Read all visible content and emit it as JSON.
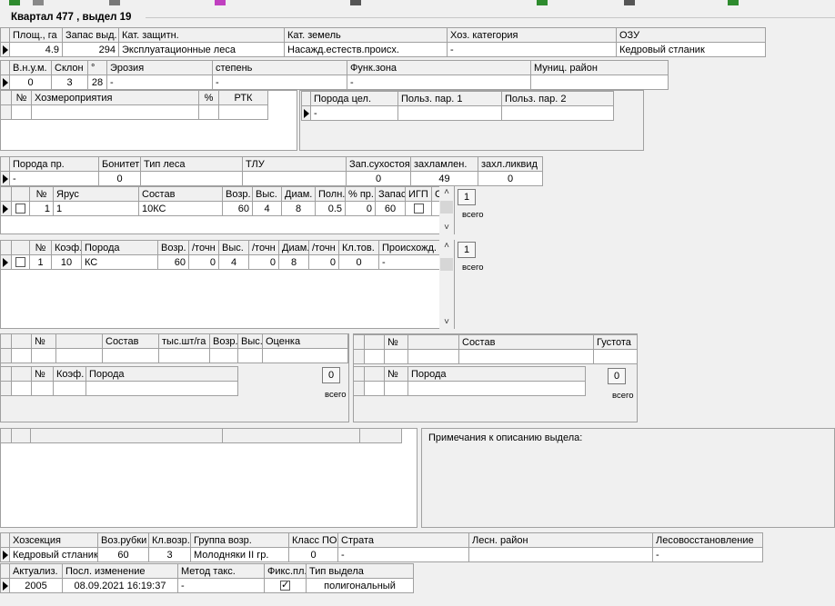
{
  "title": "Квартал 477 ,  выдел 19",
  "main": {
    "headers": [
      "Площ., га",
      "Запас выд.",
      "Кат. защитн.",
      "Кат. земель",
      "Хоз. категория",
      "ОЗУ"
    ],
    "row": [
      "4.9",
      "294",
      "Эксплуатационные леса",
      "Насажд.естеств.происх.",
      "-",
      "Кедровый стланик"
    ]
  },
  "terrain": {
    "headers": [
      "В.н.у.м.",
      "Склон",
      "°",
      "Эрозия",
      "степень",
      "Функ.зона",
      "Муниц. район"
    ],
    "row": [
      "0",
      "3",
      "28",
      "-",
      "-",
      "-",
      ""
    ]
  },
  "measures": {
    "headers": [
      "№",
      "Хозмероприятия",
      "%",
      "РТК"
    ]
  },
  "target_species": {
    "headers": [
      "Порода цел.",
      "Польз. пар. 1",
      "Польз. пар. 2"
    ],
    "row": [
      "-",
      "",
      ""
    ]
  },
  "stand": {
    "headers": [
      "Порода пр.",
      "Бонитет",
      "Тип леса",
      "ТЛУ",
      "Зап.сухостоя",
      "захламлен.",
      "захл.ликвид"
    ],
    "row": [
      "-",
      "0",
      "",
      "",
      "0",
      "49",
      "0"
    ]
  },
  "layers": {
    "headers": [
      "№",
      "Ярус",
      "Состав",
      "Возр.",
      "Выс.",
      "Диам.",
      "Полн.",
      "% пр.",
      "Запас",
      "ИГП",
      "С"
    ],
    "rows": [
      [
        "1",
        "1",
        "10КС",
        "60",
        "4",
        "8",
        "0.5",
        "0",
        "60",
        "",
        ""
      ]
    ],
    "count": "1",
    "count_label": "всего"
  },
  "species": {
    "headers": [
      "№",
      "Коэф.",
      "Порода",
      "Возр.",
      "/точн",
      "Выс.",
      "/точн",
      "Диам.",
      "/точн",
      "Кл.тов.",
      "Происхожд."
    ],
    "rows": [
      [
        "1",
        "10",
        "КС",
        "60",
        "0",
        "4",
        "0",
        "8",
        "0",
        "0",
        "-"
      ]
    ],
    "count": "1",
    "count_label": "всего"
  },
  "undergrowth": {
    "headers": [
      "№",
      "Состав",
      "тыс.шт/га",
      "Возр.",
      "Выс.",
      "Оценка"
    ]
  },
  "undergrowth_species": {
    "headers": [
      "№",
      "Коэф.",
      "Порода"
    ],
    "count": "0",
    "count_label": "всего"
  },
  "shrubs": {
    "headers": [
      "№",
      "Состав",
      "Густота"
    ]
  },
  "shrub_species": {
    "headers": [
      "№",
      "Порода"
    ],
    "count": "0",
    "count_label": "всего"
  },
  "notes_label": "Примечания к описанию выдела:",
  "economy": {
    "headers": [
      "Хозсекция",
      "Воз.рубки",
      "Кл.возр.",
      "Группа возр.",
      "Класс ПО",
      "Страта",
      "Лесн. район",
      "Лесовосстановление"
    ],
    "row": [
      "Кедровый стланик",
      "60",
      "3",
      "Молодняки II гр.",
      "0",
      "-",
      "",
      "-"
    ]
  },
  "audit": {
    "headers": [
      "Актуализ.",
      "Посл. изменение",
      "Метод такс.",
      "Фикс.пл.",
      "Тип выдела"
    ],
    "row": [
      "2005",
      "08.09.2021 16:19:37",
      "-",
      "",
      "полигональный"
    ]
  }
}
